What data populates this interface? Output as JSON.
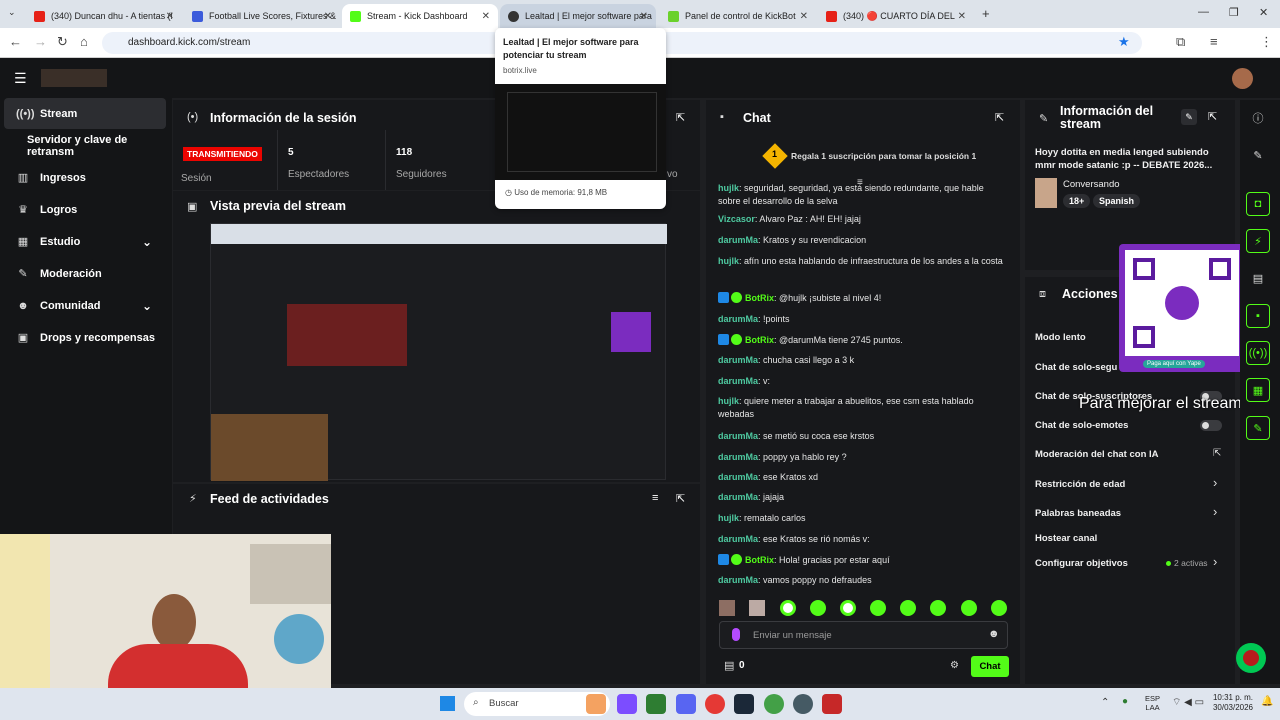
{
  "browser": {
    "tabs": [
      {
        "title": "(340) Duncan dhu - A tientas (l",
        "fav": "#e62117"
      },
      {
        "title": "Football Live Scores, Fixtures &",
        "fav": "#3b5bdb"
      },
      {
        "title": "Stream - Kick Dashboard",
        "fav": "#53fc18"
      },
      {
        "title": "Lealtad | El mejor software para",
        "fav": "#333"
      },
      {
        "title": "Panel de control de KickBot",
        "fav": "#6ad12b"
      },
      {
        "title": "(340) 🔴 CUARTO DÍA DEL",
        "fav": "#e62117"
      }
    ],
    "url": "dashboard.kick.com/stream",
    "tooltip": {
      "title": "Lealtad | El mejor software para potenciar tu stream",
      "domain": "botrix.live",
      "memory": "Uso de memoria: 91,8 MB"
    }
  },
  "sidebar": {
    "items": [
      {
        "label": "Stream",
        "icon": "broadcast-icon"
      },
      {
        "label": "Servidor y clave de retransm",
        "icon": ""
      },
      {
        "label": "Ingresos",
        "icon": "bars-icon"
      },
      {
        "label": "Logros",
        "icon": "trophy-icon"
      },
      {
        "label": "Estudio",
        "icon": "studio-icon"
      },
      {
        "label": "Moderación",
        "icon": "wrench-icon"
      },
      {
        "label": "Comunidad",
        "icon": "people-icon"
      },
      {
        "label": "Drops y recompensas",
        "icon": "gift-icon"
      }
    ]
  },
  "session": {
    "title": "Información de la sesión",
    "status": "TRANSMITIENDO",
    "session_label": "Sesión",
    "viewers": "5",
    "viewers_label": "Espectadores",
    "followers": "118",
    "followers_label": "Seguidores",
    "partial_label": "vo"
  },
  "preview": {
    "title": "Vista previa del stream"
  },
  "feed": {
    "title": "Feed de actividades"
  },
  "chat": {
    "title": "Chat",
    "gift_rank": "1",
    "gift_text": "Regala 1 suscripción para tomar la posición 1",
    "messages": [
      {
        "user": "hujlk",
        "text": "seguridad, seguridad, ya está siendo redundante, que hable sobre el desarrollo de la selva",
        "bot": false
      },
      {
        "user": "Vizcasor",
        "text": "Alvaro Paz : AH! EH! jajaj",
        "bot": false
      },
      {
        "user": "darumMa",
        "text": "Kratos y su revendicacion",
        "bot": false
      },
      {
        "user": "hujlk",
        "text": "afín uno esta hablando de infraestructura de los andes a la costa",
        "bot": false
      },
      {
        "user": "BotRix",
        "text": "@hujlk ¡subiste al nivel 4!",
        "bot": true
      },
      {
        "user": "darumMa",
        "text": "!points",
        "bot": false
      },
      {
        "user": "BotRix",
        "text": "@darumMa tiene 2745 puntos.",
        "bot": true
      },
      {
        "user": "darumMa",
        "text": "chucha casi llego a 3 k",
        "bot": false
      },
      {
        "user": "darumMa",
        "text": "v:",
        "bot": false
      },
      {
        "user": "hujlk",
        "text": "quiere meter a trabajar a abuelitos, ese csm esta hablado webadas",
        "bot": false
      },
      {
        "user": "darumMa",
        "text": "se metió su coca ese krstos",
        "bot": false
      },
      {
        "user": "darumMa",
        "text": "poppy ya hablo rey ?",
        "bot": false
      },
      {
        "user": "darumMa",
        "text": "ese Kratos xd",
        "bot": false
      },
      {
        "user": "darumMa",
        "text": "jajaja",
        "bot": false
      },
      {
        "user": "hujlk",
        "text": "rematalo carlos",
        "bot": false
      },
      {
        "user": "darumMa",
        "text": "ese Kratos se rió nomás v:",
        "bot": false
      },
      {
        "user": "BotRix",
        "text": "Hola! gracias por estar aquí",
        "bot": true
      },
      {
        "user": "darumMa",
        "text": "vamos poppy no defraudes",
        "bot": false
      }
    ],
    "input_placeholder": "Enviar un mensaje",
    "points": "0",
    "send_label": "Chat"
  },
  "stream_info": {
    "title": "Información del stream",
    "stream_title": "Hoyy dotita en media lenged subiendo mmr mode satanic :p -- DEBATE 2026...",
    "category": "Conversando",
    "tags": [
      "18+",
      "Spanish"
    ]
  },
  "actions": {
    "title": "Acciones",
    "rows": [
      {
        "label": "Modo lento"
      },
      {
        "label": "Chat de solo-segu"
      },
      {
        "label": "Chat de solo-suscriptores"
      },
      {
        "label": "Chat de solo-emotes"
      },
      {
        "label": "Moderación del chat con IA"
      },
      {
        "label": "Restricción de edad"
      },
      {
        "label": "Palabras baneadas"
      },
      {
        "label": "Hostear canal"
      },
      {
        "label": "Configurar objetivos"
      }
    ],
    "objetivos_status": "2 activas"
  },
  "overlay": {
    "caption": "Para mejorar el stream",
    "qr_caption": "Paga aquí con Yape"
  },
  "taskbar": {
    "search": "Buscar",
    "lang": "ESP",
    "lang2": "LAA",
    "time": "10:31 p. m.",
    "date": "30/03/2026"
  },
  "colors": {
    "accent": "#53fc18",
    "live": "#eb0400",
    "panel": "#17181b",
    "bg": "#1e1f22"
  }
}
